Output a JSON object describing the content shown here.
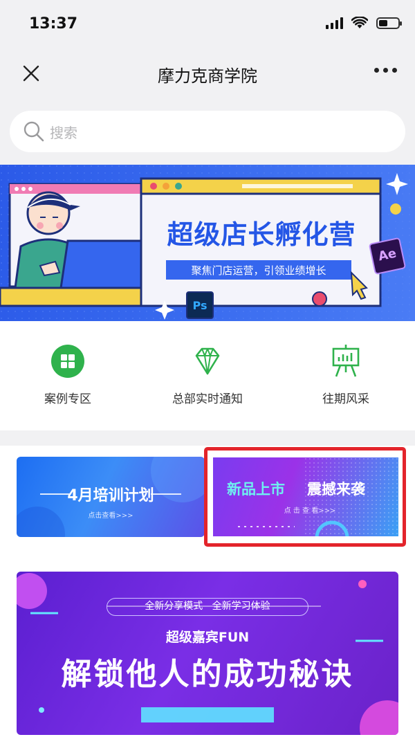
{
  "status_bar": {
    "time": "13:37"
  },
  "nav": {
    "title": "摩力克商学院"
  },
  "search": {
    "placeholder": "搜索"
  },
  "hero": {
    "title": "超级店长孵化营",
    "subtitle": "聚焦门店运营，引领业绩增长",
    "badge_ps": "Ps",
    "badge_ae": "Ae"
  },
  "quick_menu": [
    {
      "label": "案例专区",
      "icon": "grid-icon"
    },
    {
      "label": "总部实时通知",
      "icon": "diamond-icon"
    },
    {
      "label": "往期风采",
      "icon": "presentation-board-icon"
    }
  ],
  "cards": {
    "training": {
      "title": "4月培训计划",
      "sub": "点击查看>>>"
    },
    "new_product": {
      "title_a": "新品上市",
      "title_b": "震撼来袭",
      "sub": "点 击 查 看>>>"
    },
    "share": {
      "tag": "全新分享模式   全新学习体验",
      "headline": "超级嘉宾FUN",
      "title": "解锁他人的成功秘诀"
    }
  },
  "colors": {
    "accent_green": "#2fb24c",
    "highlight_red": "#e3242b",
    "hero_blue": "#3566ee",
    "title_blue": "#2456e6"
  }
}
